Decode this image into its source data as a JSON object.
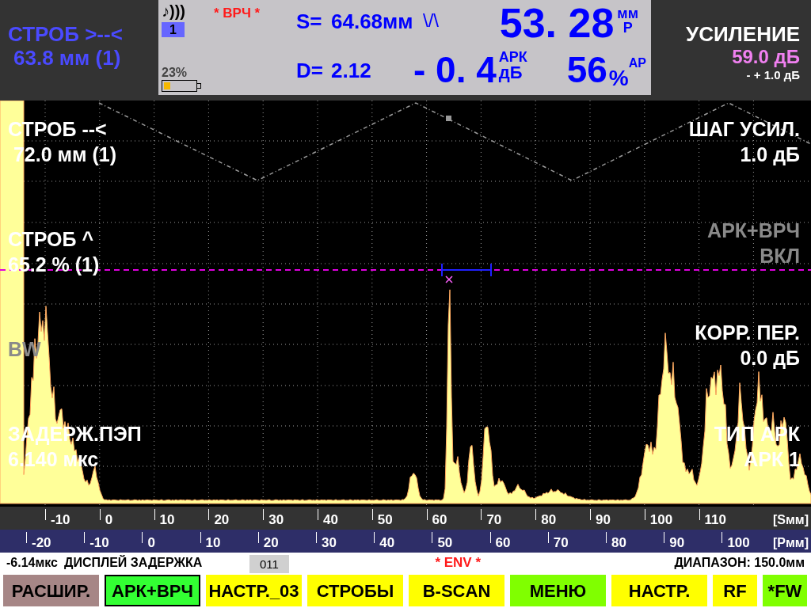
{
  "left_readout": {
    "label": "СТРОБ >--<",
    "value": "63.8 мм (1)"
  },
  "status_panel": {
    "probe_icon": "♪)))",
    "channel": "1",
    "battery_reading": "23%",
    "mode": "* ВРЧ *",
    "s_label": "S=",
    "s_value": "64.68мм",
    "wave_glyph": "\\/\\",
    "d_label": "D=",
    "d_value": "2.12",
    "gain_offset": {
      "value": "- 0. 4",
      "unit_top": "АРК",
      "unit_bottom": "дБ"
    },
    "depth": {
      "value": "53. 28",
      "unit_top": "мм",
      "unit_bottom": "Р"
    },
    "amplitude": {
      "value": "56",
      "unit": "%",
      "sup": "АР"
    }
  },
  "gain": {
    "label": "УСИЛЕНИЕ",
    "value": "59.0 дБ",
    "step": "- + 1.0 дБ"
  },
  "overlay_left": [
    {
      "title": "СТРОБ --<",
      "value": " 72.0 мм (1)",
      "dimmed": false
    },
    {
      "title": "СТРОБ ^",
      "value": "65.2 % (1)",
      "dimmed": false
    },
    {
      "title": "BW",
      "dimmed": true
    },
    {
      "title": "ЗАДЕРЖ.ПЭП",
      "value": "6.140 мкс",
      "dimmed": false
    }
  ],
  "overlay_right": [
    {
      "title": "ШАГ УСИЛ.",
      "value": "1.0 дБ",
      "dimmed": false
    },
    {
      "title": "АРК+ВРЧ",
      "value": "ВКЛ",
      "dimmed": true
    },
    {
      "title": "КОРР. ПЕР.",
      "value": "0.0 дБ",
      "dimmed": false
    },
    {
      "title": "ТИП АРК",
      "value": "АРК 1",
      "dimmed": false
    }
  ],
  "s_scale": {
    "ticks": [
      "-10",
      "0",
      "10",
      "20",
      "30",
      "40",
      "50",
      "60",
      "70",
      "80",
      "90",
      "100",
      "110"
    ],
    "unit": "[Sмм]"
  },
  "p_scale": {
    "ticks": [
      "-20",
      "-10",
      "0",
      "10",
      "20",
      "30",
      "40",
      "50",
      "60",
      "70",
      "80",
      "90",
      "100"
    ],
    "unit": "[Рмм]"
  },
  "status_line": {
    "delay": "-6.14мкс",
    "delay_label": "ДИСПЛЕЙ ЗАДЕРЖКА",
    "code": "011",
    "mode": "* ENV *",
    "range": "ДИАПАЗОН: 150.0мм"
  },
  "softkeys": [
    {
      "label": "РАСШИР.",
      "color": "#a68686",
      "selected": false
    },
    {
      "label": "АРК+ВРЧ",
      "color": "#33ff33",
      "selected": true
    },
    {
      "label": "НАСТР._03",
      "color": "#ffff00",
      "selected": false
    },
    {
      "label": "СТРОБЫ",
      "color": "#ffff00",
      "selected": false
    },
    {
      "label": "B-SCAN",
      "color": "#ffff00",
      "selected": false
    },
    {
      "label": "МЕНЮ",
      "color": "#80ff00",
      "selected": false
    },
    {
      "label": "НАСТР.",
      "color": "#ffff00",
      "selected": false
    },
    {
      "label": "RF",
      "color": "#ffff00",
      "selected": false
    },
    {
      "label": "*FW",
      "color": "#80ff00",
      "selected": false
    }
  ]
}
